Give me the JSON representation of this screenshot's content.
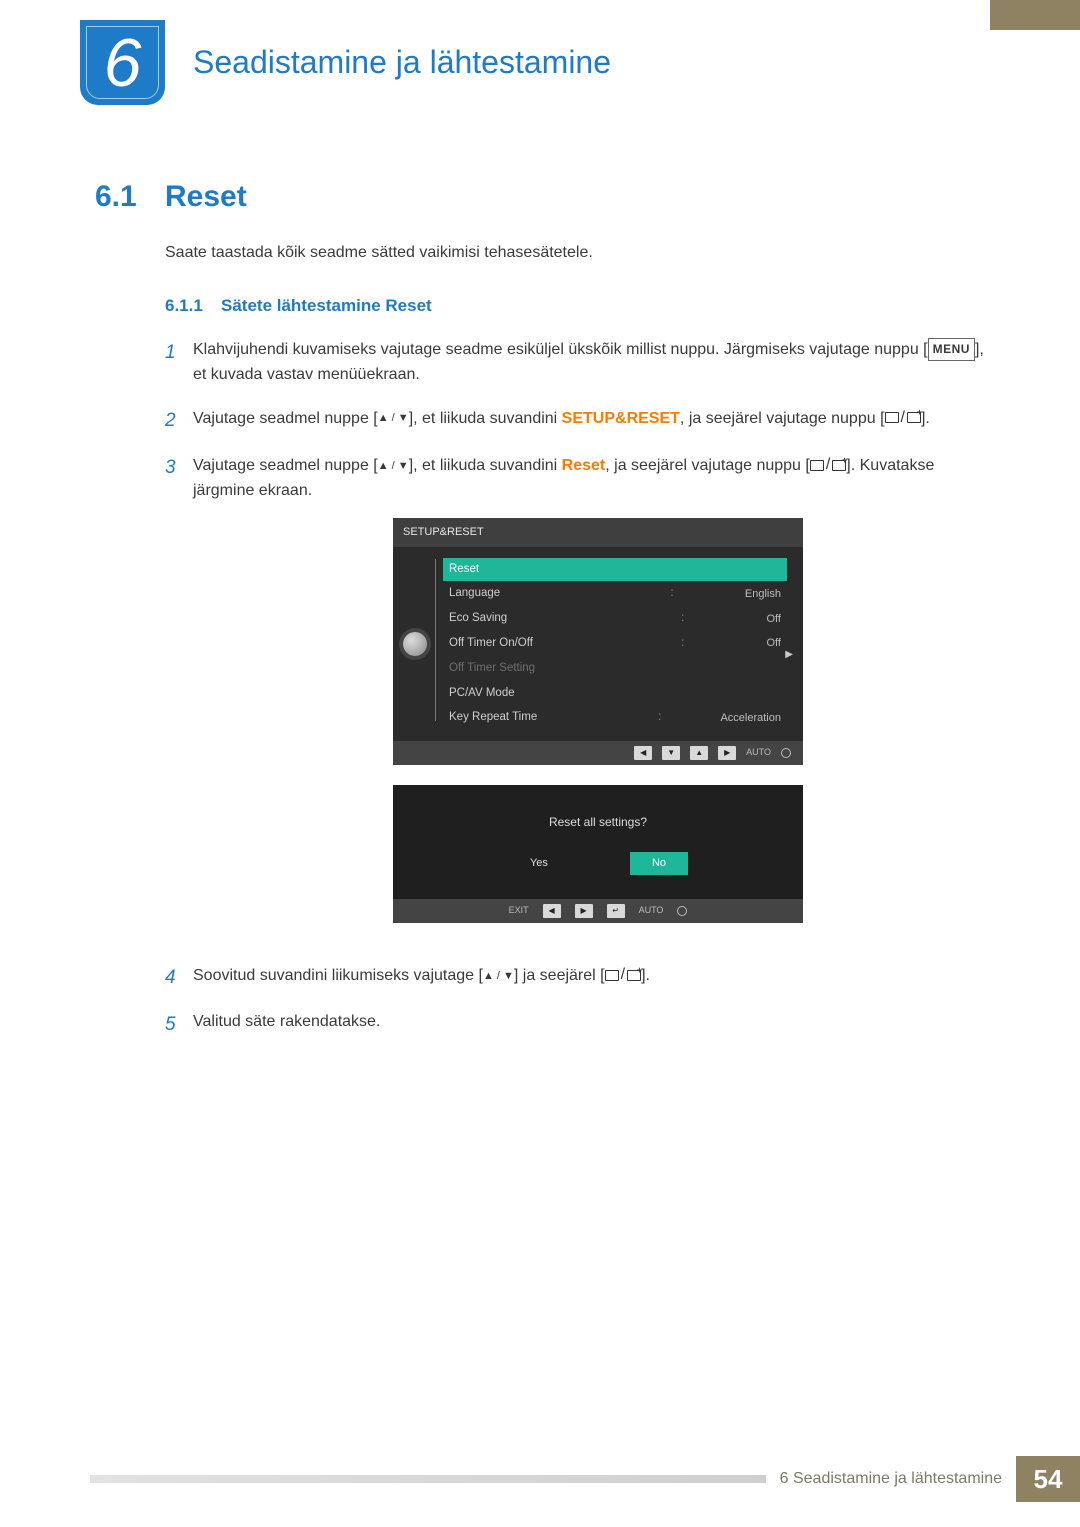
{
  "chapter": {
    "number": "6",
    "title": "Seadistamine ja lähtestamine"
  },
  "section": {
    "number": "6.1",
    "title": "Reset"
  },
  "intro": "Saate taastada kõik seadme sätted vaikimisi tehasesätetele.",
  "subsection": {
    "number": "6.1.1",
    "title": "Sätete lähtestamine Reset"
  },
  "button_labels": {
    "menu": "MENU"
  },
  "steps": {
    "1": {
      "a": "Klahvijuhendi kuvamiseks vajutage seadme esiküljel ükskõik millist nuppu. Järgmiseks vajutage nuppu [",
      "b": "], et kuvada vastav menüüekraan."
    },
    "2": {
      "a": "Vajutage seadmel nuppe [",
      "b": "], et liikuda suvandini ",
      "hl": "SETUP&RESET",
      "c": ", ja seejärel vajutage nuppu [",
      "d": "]."
    },
    "3": {
      "a": "Vajutage seadmel nuppe [",
      "b": "], et liikuda suvandini ",
      "hl": "Reset",
      "c": ", ja seejärel vajutage nuppu [",
      "d": "]. Kuvatakse järgmine ekraan."
    },
    "4": {
      "a": "Soovitud suvandini liikumiseks vajutage [",
      "b": "] ja seejärel [",
      "c": "]."
    },
    "5": {
      "a": "Valitud säte rakendatakse."
    }
  },
  "osd_menu": {
    "title": "SETUP&RESET",
    "rows": [
      {
        "label": "Reset",
        "value": "",
        "sel": true
      },
      {
        "label": "Language",
        "value": "English"
      },
      {
        "label": "Eco Saving",
        "value": "Off"
      },
      {
        "label": "Off Timer On/Off",
        "value": "Off"
      },
      {
        "label": "Off Timer Setting",
        "value": "",
        "dim": true
      },
      {
        "label": "PC/AV Mode",
        "value": ""
      },
      {
        "label": "Key Repeat Time",
        "value": "Acceleration"
      }
    ],
    "footer_auto": "AUTO"
  },
  "osd_dialog": {
    "question": "Reset all settings?",
    "yes": "Yes",
    "no": "No",
    "exit": "EXIT",
    "auto": "AUTO"
  },
  "footer": {
    "label": "6 Seadistamine ja lähtestamine",
    "page": "54"
  }
}
